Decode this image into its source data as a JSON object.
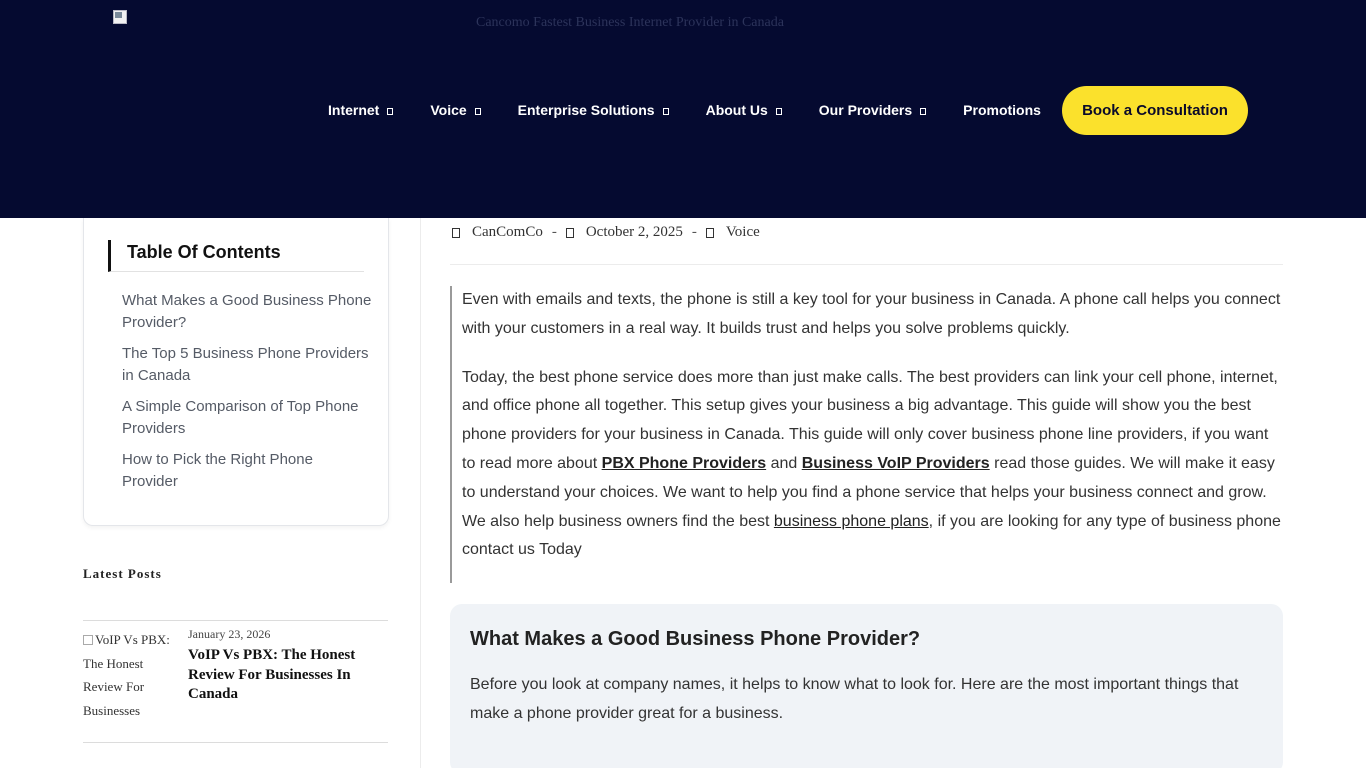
{
  "header": {
    "logo_alt": "Cancomo Fastest Business Internet Provider in Canada",
    "nav": [
      {
        "label": "Internet",
        "has_dropdown": true
      },
      {
        "label": "Voice",
        "has_dropdown": true
      },
      {
        "label": "Enterprise Solutions",
        "has_dropdown": true
      },
      {
        "label": "About Us",
        "has_dropdown": true
      },
      {
        "label": "Our Providers",
        "has_dropdown": true
      },
      {
        "label": "Promotions",
        "has_dropdown": false
      }
    ],
    "cta_label": "Book a Consultation",
    "bg_color": "#050a30",
    "cta_color": "#fbe12c"
  },
  "toc": {
    "title": "Table Of Contents",
    "items": [
      "What Makes a Good Business Phone Provider?",
      "The Top 5 Business Phone Providers in Canada",
      "A Simple Comparison of Top Phone Providers",
      "How to Pick the Right Phone Provider"
    ]
  },
  "latest": {
    "title": "Latest Posts",
    "posts": [
      {
        "thumb_alt": "VoIP Vs PBX: The Honest Review For Businesses",
        "date": "January 23, 2026",
        "title": "VoIP Vs PBX: The Honest Review For Businesses In Canada"
      }
    ]
  },
  "meta": {
    "author": "CanComCo",
    "date": "October 2, 2025",
    "category": "Voice",
    "separator": "-",
    "author_icon": "user-icon",
    "date_icon": "calendar-icon",
    "category_icon": "folder-icon"
  },
  "intro": {
    "p1": "Even with emails and texts, the phone is still a key tool for your business in Canada. A phone call helps you connect with your customers in a real way. It builds trust and helps you solve problems quickly.",
    "p2_a": "Today, the best phone service does more than just make calls. The best providers can link your cell phone, internet, and office phone all together. This setup gives your business a big advantage. This guide will show you the best phone providers for your business in Canada. This guide will only cover business phone line providers, if you want to read more about ",
    "link_pbx": "PBX Phone Providers",
    "p2_b": " and ",
    "link_voip": "Business VoIP Providers",
    "p2_c": " read those guides. We will make it easy to understand your choices. We want to help you find a phone service that helps your business connect and grow. We also help business owners find the best ",
    "link_plans": "business phone plans",
    "p2_d": ", if you are looking for any type of business phone contact us Today"
  },
  "section": {
    "title": "What Makes a Good Business Phone Provider?",
    "body": "Before you look at company names, it helps to know what to look for. Here are the most important things that make a phone provider great for a business."
  }
}
